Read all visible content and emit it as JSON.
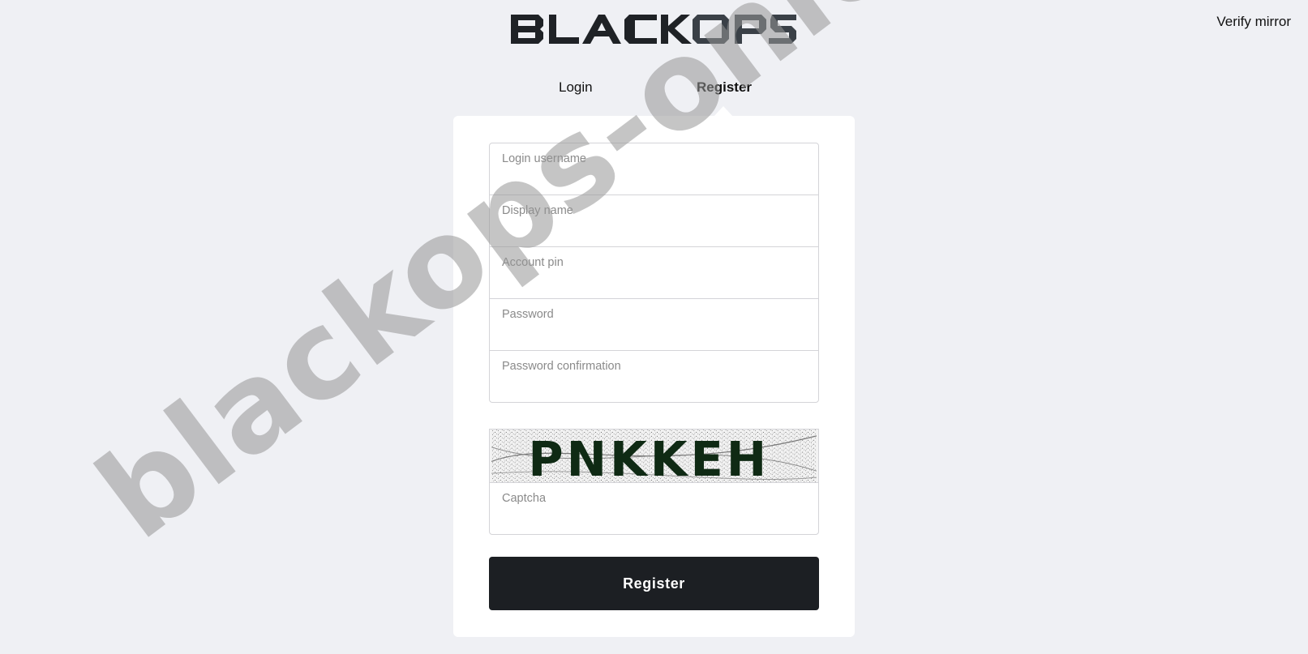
{
  "header": {
    "logo_text": "BLACK OPS",
    "verify_link": "Verify mirror"
  },
  "tabs": [
    {
      "label": "Login",
      "active": false
    },
    {
      "label": "Register",
      "active": true
    }
  ],
  "form": {
    "fields": [
      {
        "label": "Login username",
        "value": ""
      },
      {
        "label": "Display name",
        "value": ""
      },
      {
        "label": "Account pin",
        "value": ""
      },
      {
        "label": "Password",
        "value": ""
      },
      {
        "label": "Password confirmation",
        "value": ""
      }
    ],
    "captcha": {
      "image_text": "PNKKEH",
      "label": "Captcha",
      "value": ""
    },
    "submit_label": "Register"
  },
  "watermark": "blackops-onion.cyou",
  "colors": {
    "background": "#eff0f4",
    "card": "#ffffff",
    "button": "#1c1f23",
    "logo_dark": "#1f2226",
    "logo_accent": "#3a4047"
  }
}
